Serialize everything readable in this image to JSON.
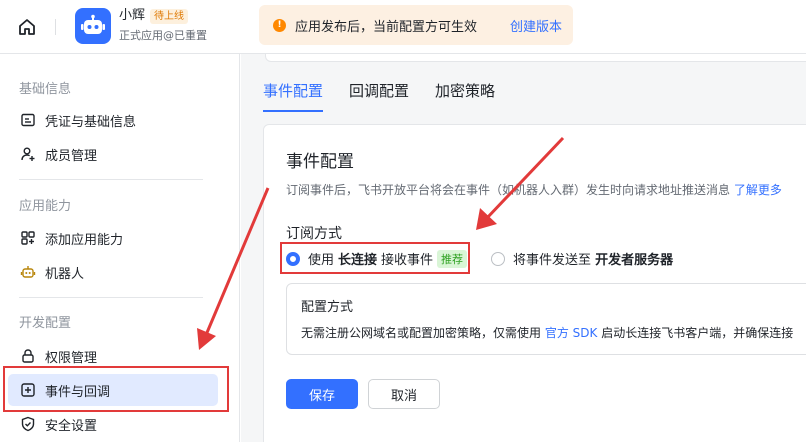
{
  "header": {
    "app_name": "小辉",
    "status_badge": "待上线",
    "app_subtitle": "正式应用@已重置",
    "notice_icon": "!",
    "notice_text": "应用发布后，当前配置方可生效",
    "notice_link": "创建版本"
  },
  "sidebar": {
    "groups": [
      {
        "title": "基础信息",
        "items": [
          {
            "label": "凭证与基础信息",
            "icon": "id-card-icon"
          },
          {
            "label": "成员管理",
            "icon": "user-add-icon"
          }
        ]
      },
      {
        "title": "应用能力",
        "items": [
          {
            "label": "添加应用能力",
            "icon": "grid-add-icon"
          },
          {
            "label": "机器人",
            "icon": "robot-icon"
          }
        ]
      },
      {
        "title": "开发配置",
        "items": [
          {
            "label": "权限管理",
            "icon": "lock-icon"
          },
          {
            "label": "事件与回调",
            "icon": "event-icon",
            "active": true
          },
          {
            "label": "安全设置",
            "icon": "shield-icon"
          }
        ]
      }
    ]
  },
  "main": {
    "tabs": [
      "事件配置",
      "回调配置",
      "加密策略"
    ],
    "section_title": "事件配置",
    "section_desc": "订阅事件后，飞书开放平台将会在事件（如机器人入群）发生时向请求地址推送消息",
    "section_desc_link": "了解更多",
    "subscribe_title": "订阅方式",
    "option1": {
      "prefix": "使用",
      "bold": "长连接",
      "suffix": "接收事件",
      "badge": "推荐"
    },
    "option2": {
      "prefix": "将事件发送至",
      "bold": "开发者服务器"
    },
    "config_title": "配置方式",
    "config_text_before": "无需注册公网域名或配置加密策略，仅需使用",
    "config_link": "官方 SDK",
    "config_text_after": "启动长连接飞书客户端，并确保连接",
    "save_label": "保存",
    "cancel_label": "取消"
  },
  "colors": {
    "accent": "#3370ff",
    "annotation": "#e23a3a"
  }
}
